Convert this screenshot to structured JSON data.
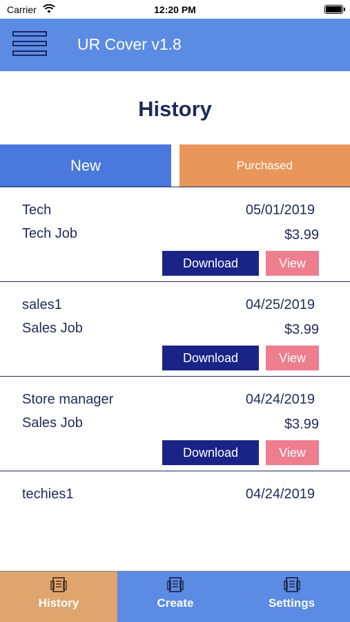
{
  "status_bar": {
    "carrier": "Carrier",
    "time": "12:20 PM"
  },
  "header": {
    "title": "UR Cover v1.8",
    "menu_icon": "hamburger-menu-icon"
  },
  "page": {
    "title": "History"
  },
  "tabs": [
    {
      "label": "New",
      "active": true
    },
    {
      "label": "Purchased",
      "active": false
    }
  ],
  "items": [
    {
      "name": "Tech",
      "date": "05/01/2019",
      "type": "Tech Job",
      "price": "$3.99",
      "download_label": "Download",
      "view_label": "View"
    },
    {
      "name": "sales1",
      "date": "04/25/2019",
      "type": "Sales Job",
      "price": "$3.99",
      "download_label": "Download",
      "view_label": "View"
    },
    {
      "name": "Store manager",
      "date": "04/24/2019",
      "type": "Sales Job",
      "price": "$3.99",
      "download_label": "Download",
      "view_label": "View"
    },
    {
      "name": "techies1",
      "date": "04/24/2019"
    }
  ],
  "tab_bar": [
    {
      "label": "History",
      "icon": "document-icon",
      "active": true
    },
    {
      "label": "Create",
      "icon": "document-icon",
      "active": false
    },
    {
      "label": "Settings",
      "icon": "document-icon",
      "active": false
    }
  ],
  "colors": {
    "nav_blue": "#5b8be3",
    "tab_new": "#4a78dc",
    "tab_purchased": "#e8965a",
    "download_button": "#1a2387",
    "view_button": "#ee7e8e",
    "active_tab_bar": "#e0a46e",
    "text_navy": "#1f2a5c"
  }
}
